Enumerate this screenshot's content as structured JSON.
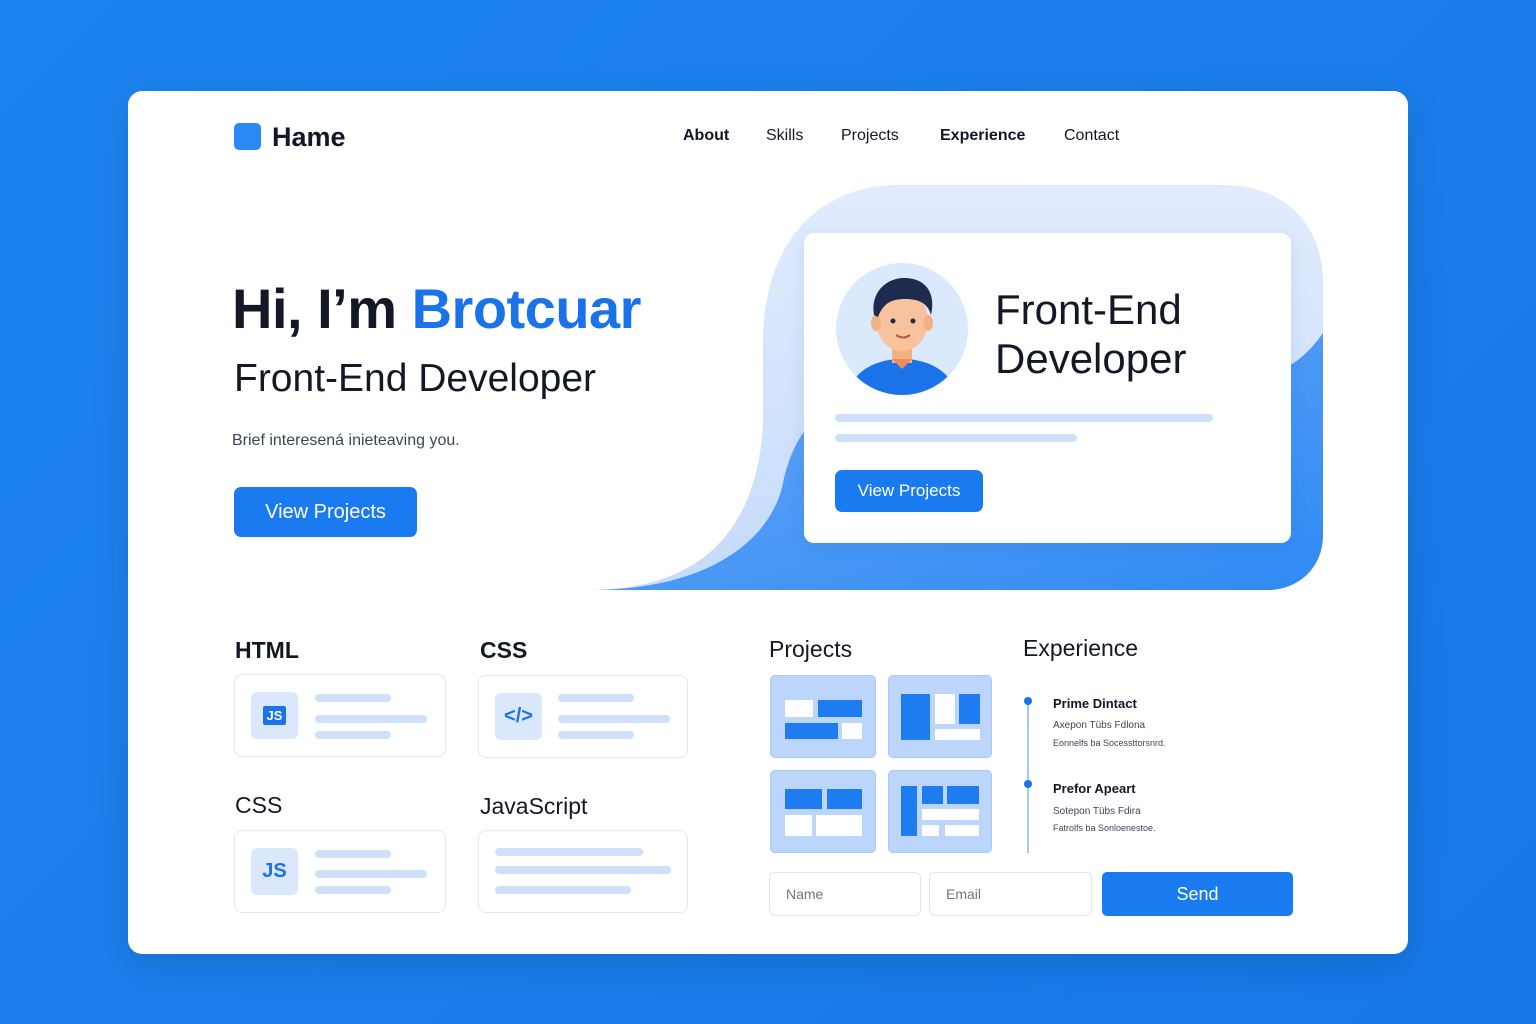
{
  "brand": {
    "name": "Hame"
  },
  "nav": {
    "items": [
      "About",
      "Skills",
      "Projects",
      "Experience",
      "Contact"
    ]
  },
  "hero": {
    "greeting": "Hi, I’m ",
    "name": "Brotcuar",
    "subtitle": "Front-End Developer",
    "brief": "Brief interesená inieteaving you.",
    "cta": "View Projects"
  },
  "profile_card": {
    "title": "Front-End Developer",
    "cta": "View Projects"
  },
  "skills": {
    "labels": [
      "HTML",
      "CSS",
      "CSS",
      "JavaScript"
    ],
    "icons": [
      "JS",
      "</>",
      "JS"
    ]
  },
  "projects": {
    "title": "Projects"
  },
  "experience": {
    "title": "Experience",
    "entries": [
      {
        "title": "Prime Dintact",
        "line1": "Axepon Tübs Fdlona",
        "line2": "Eonnelfs ba Socessttorsnrd."
      },
      {
        "title": "Prefor Apeart",
        "line1": "Sotepon Tübs Fdira",
        "line2": "Fatrolfs ba Sonloenestoe."
      }
    ]
  },
  "contact": {
    "name_placeholder": "Name",
    "email_placeholder": "Email",
    "send": "Send"
  },
  "colors": {
    "accent": "#1a73e8",
    "background": "#1a7de8",
    "soft": "#cfe0fb"
  }
}
